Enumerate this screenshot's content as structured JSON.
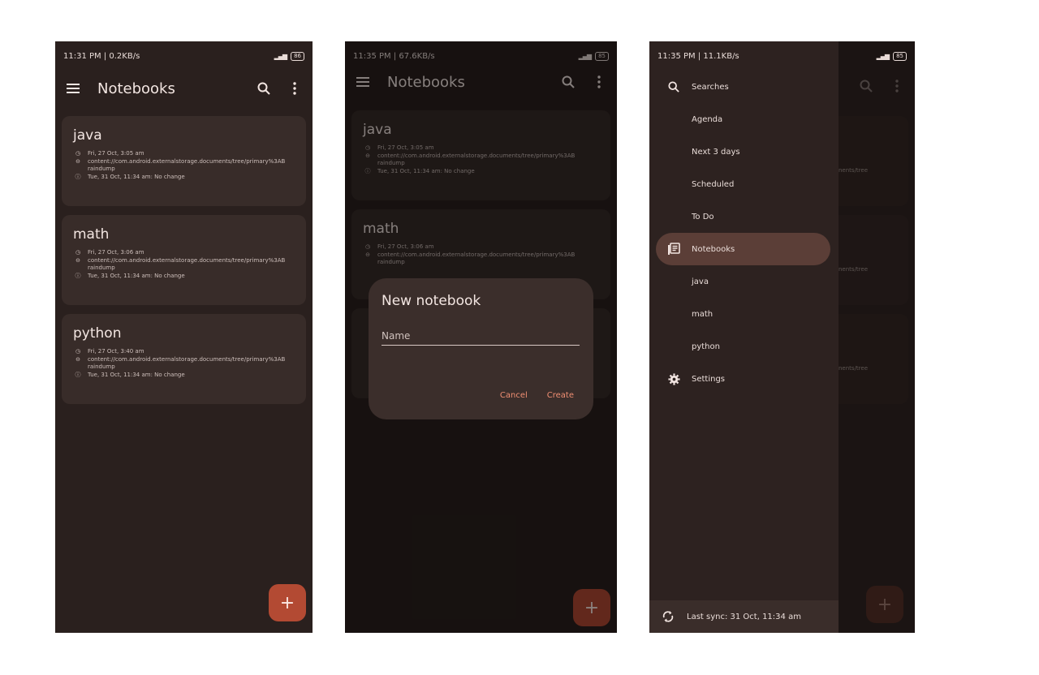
{
  "screen1": {
    "status": {
      "time": "11:31 PM | 0.2KB/s",
      "battery": "86"
    },
    "title": "Notebooks",
    "notebooks": [
      {
        "name": "java",
        "created": "Fri, 27 Oct, 3:05 am",
        "path": "content://com.android.externalstorage.documents/tree/primary%3ABraindump",
        "sync": "Tue, 31 Oct, 11:34 am: No change"
      },
      {
        "name": "math",
        "created": "Fri, 27 Oct, 3:06 am",
        "path": "content://com.android.externalstorage.documents/tree/primary%3ABraindump",
        "sync": "Tue, 31 Oct, 11:34 am: No change"
      },
      {
        "name": "python",
        "created": "Fri, 27 Oct, 3:40 am",
        "path": "content://com.android.externalstorage.documents/tree/primary%3ABraindump",
        "sync": "Tue, 31 Oct, 11:34 am: No change"
      }
    ],
    "fab_label": "+"
  },
  "screen2": {
    "status": {
      "time": "11:35 PM | 67.6KB/s",
      "battery": "85"
    },
    "title": "Notebooks",
    "notebooks": [
      {
        "name": "java",
        "created": "Fri, 27 Oct, 3:05 am",
        "path": "content://com.android.externalstorage.documents/tree/primary%3ABraindump",
        "sync": "Tue, 31 Oct, 11:34 am: No change"
      },
      {
        "name": "math",
        "created": "Fri, 27 Oct, 3:06 am",
        "path": "content://com.android.externalstorage.documents/tree/primary%3ABraindump",
        "sync": ""
      }
    ],
    "dialog": {
      "title": "New notebook",
      "name_placeholder": "Name",
      "name_value": "",
      "cancel": "Cancel",
      "create": "Create"
    },
    "fab_label": "+"
  },
  "screen3": {
    "status": {
      "time": "11:35 PM | 11.1KB/s",
      "battery": "85"
    },
    "menu": {
      "searches": "Searches",
      "agenda": "Agenda",
      "next3": "Next 3 days",
      "scheduled": "Scheduled",
      "todo": "To Do",
      "notebooks": "Notebooks",
      "java": "java",
      "math": "math",
      "python": "python",
      "settings": "Settings"
    },
    "last_sync": "Last sync: 31 Oct, 11:34 am",
    "peek_text": "nents/tree",
    "fab_label": "+"
  },
  "colors": {
    "background": "#2a201e",
    "card": "#382c29",
    "accent": "#b34a33",
    "link": "#f08f73",
    "active_item": "#5b3e37"
  }
}
